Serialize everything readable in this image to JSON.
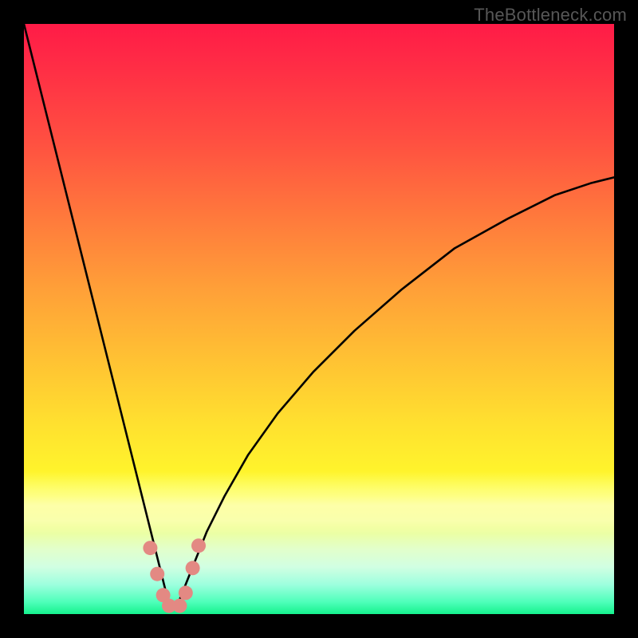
{
  "watermark": "TheBottleneck.com",
  "chart_data": {
    "type": "line",
    "title": "",
    "xlabel": "",
    "ylabel": "",
    "xlim": [
      0,
      100
    ],
    "ylim": [
      0,
      100
    ],
    "grid": false,
    "legend": false,
    "series": [
      {
        "name": "curve",
        "x": [
          0,
          2,
          4,
          6,
          8,
          10,
          12,
          14,
          16,
          18,
          20,
          21.5,
          23,
          24,
          24.8,
          25.4,
          26,
          27,
          29,
          31,
          34,
          38,
          43,
          49,
          56,
          64,
          73,
          82,
          90,
          96,
          100
        ],
        "values": [
          100,
          92,
          84,
          76,
          68,
          60,
          52,
          44,
          36,
          28,
          20,
          14,
          8,
          4,
          1.5,
          0.9,
          1.5,
          4,
          9,
          14,
          20,
          27,
          34,
          41,
          48,
          55,
          62,
          67,
          71,
          73,
          74
        ]
      }
    ],
    "markers": [
      {
        "x": 21.4,
        "y": 11.2
      },
      {
        "x": 22.6,
        "y": 6.8
      },
      {
        "x": 23.6,
        "y": 3.2
      },
      {
        "x": 24.6,
        "y": 1.4
      },
      {
        "x": 26.4,
        "y": 1.4
      },
      {
        "x": 27.4,
        "y": 3.6
      },
      {
        "x": 28.6,
        "y": 7.8
      },
      {
        "x": 29.6,
        "y": 11.6
      }
    ],
    "colors": {
      "curve_stroke": "#000000",
      "marker_fill": "#e38983",
      "gradient_top": "#ff1b47",
      "gradient_bottom": "#15f28d",
      "background": "#000000"
    }
  }
}
